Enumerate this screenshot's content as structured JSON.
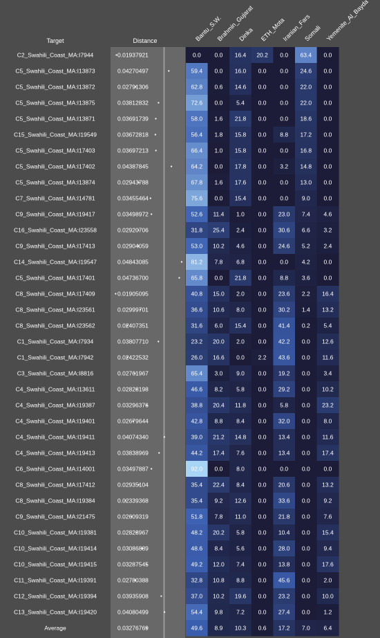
{
  "chart_data": {
    "type": "heatmap",
    "header": {
      "target": "Target",
      "distance": "Distance"
    },
    "columns": [
      "Bantu_S.W.",
      "Brahmin_Gujarat",
      "Dinka",
      "ETH_Mota",
      "Iranian_Fars",
      "Somali",
      "Yemenite_Al_Bayda"
    ],
    "rows": [
      {
        "target": "C2_Swahili_Coast_MA:I7944",
        "distance": "0.01937921",
        "values": [
          0.0,
          0.0,
          16.4,
          20.2,
          0.0,
          63.4,
          0.0
        ]
      },
      {
        "target": "C5_Swahili_Coast_MA:I13873",
        "distance": "0.04270497",
        "values": [
          59.4,
          0.0,
          16.0,
          0.0,
          0.0,
          24.6,
          0.0
        ]
      },
      {
        "target": "C5_Swahili_Coast_MA:I13872",
        "distance": "0.02791306",
        "values": [
          62.8,
          0.6,
          14.6,
          0.0,
          0.0,
          22.0,
          0.0
        ]
      },
      {
        "target": "C5_Swahili_Coast_MA:I13875",
        "distance": "0.03812832",
        "values": [
          72.6,
          0.0,
          5.4,
          0.0,
          0.0,
          22.0,
          0.0
        ]
      },
      {
        "target": "C5_Swahili_Coast_MA:I13871",
        "distance": "0.03691739",
        "values": [
          58.0,
          1.6,
          21.8,
          0.0,
          0.0,
          18.6,
          0.0
        ]
      },
      {
        "target": "C15_Swahili_Coast_MA:I19549",
        "distance": "0.03672818",
        "values": [
          56.4,
          1.8,
          15.8,
          0.0,
          8.8,
          17.2,
          0.0
        ]
      },
      {
        "target": "C5_Swahili_Coast_MA:I17403",
        "distance": "0.03697213",
        "values": [
          66.4,
          1.0,
          15.8,
          0.0,
          0.0,
          16.8,
          0.0
        ]
      },
      {
        "target": "C5_Swahili_Coast_MA:I17402",
        "distance": "0.04387845",
        "values": [
          64.2,
          0.0,
          17.8,
          0.0,
          3.2,
          14.8,
          0.0
        ]
      },
      {
        "target": "C5_Swahili_Coast_MA:I13874",
        "distance": "0.02943788",
        "values": [
          67.8,
          1.6,
          17.6,
          0.0,
          0.0,
          13.0,
          0.0
        ]
      },
      {
        "target": "C7_Swahili_Coast_MA:I14781",
        "distance": "0.03455464",
        "values": [
          75.6,
          0.0,
          15.4,
          0.0,
          0.0,
          9.0,
          0.0
        ]
      },
      {
        "target": "C9_Swahili_Coast_MA:I19417",
        "distance": "0.03498972",
        "values": [
          52.6,
          11.4,
          1.0,
          0.0,
          23.0,
          7.4,
          4.6
        ]
      },
      {
        "target": "C16_Swahili_Coast_MA:I23558",
        "distance": "0.02920706",
        "values": [
          31.8,
          25.4,
          2.4,
          0.0,
          30.6,
          6.6,
          3.2
        ]
      },
      {
        "target": "C9_Swahili_Coast_MA:I17413",
        "distance": "0.02904059",
        "values": [
          53.0,
          10.2,
          4.6,
          0.0,
          24.6,
          5.2,
          2.4
        ]
      },
      {
        "target": "C14_Swahili_Coast_MA:I19547",
        "distance": "0.04843085",
        "values": [
          81.2,
          7.8,
          6.8,
          0.0,
          0.0,
          4.2,
          0.0
        ]
      },
      {
        "target": "C5_Swahili_Coast_MA:I17401",
        "distance": "0.04736700",
        "values": [
          65.8,
          0.0,
          21.8,
          0.0,
          8.8,
          3.6,
          0.0
        ]
      },
      {
        "target": "C8_Swahili_Coast_MA:I17409",
        "distance": "0.01905095",
        "values": [
          40.8,
          15.0,
          2.0,
          0.0,
          23.6,
          2.2,
          16.4
        ]
      },
      {
        "target": "C8_Swahili_Coast_MA:I23561",
        "distance": "0.02999701",
        "values": [
          36.6,
          10.6,
          8.0,
          0.0,
          30.2,
          1.4,
          13.2
        ]
      },
      {
        "target": "C8_Swahili_Coast_MA:I23562",
        "distance": "0.02407351",
        "values": [
          31.6,
          6.0,
          15.4,
          0.0,
          41.4,
          0.2,
          5.4
        ]
      },
      {
        "target": "C1_Swahili_Coast_MA:I7934",
        "distance": "0.03807710",
        "values": [
          23.2,
          20.0,
          2.0,
          0.0,
          42.2,
          0.0,
          12.6
        ]
      },
      {
        "target": "C1_Swahili_Coast_MA:I7942",
        "distance": "0.02422532",
        "values": [
          26.0,
          16.6,
          0.0,
          2.2,
          43.6,
          0.0,
          11.6
        ]
      },
      {
        "target": "C3_Swahili_Coast_MA:I8816",
        "distance": "0.02761967",
        "values": [
          65.4,
          3.0,
          9.0,
          0.0,
          19.2,
          0.0,
          3.4
        ]
      },
      {
        "target": "C4_Swahili_Coast_MA:I13611",
        "distance": "0.02828198",
        "values": [
          46.6,
          8.2,
          5.8,
          0.0,
          29.2,
          0.0,
          10.2
        ]
      },
      {
        "target": "C4_Swahili_Coast_MA:I19387",
        "distance": "0.03296376",
        "values": [
          38.8,
          20.4,
          11.8,
          0.0,
          5.8,
          0.0,
          23.2
        ]
      },
      {
        "target": "C4_Swahili_Coast_MA:I19401",
        "distance": "0.02679644",
        "values": [
          42.8,
          8.8,
          8.4,
          0.0,
          32.0,
          0.0,
          8.0
        ]
      },
      {
        "target": "C4_Swahili_Coast_MA:I19411",
        "distance": "0.04074340",
        "values": [
          39.0,
          21.2,
          14.8,
          0.0,
          13.4,
          0.0,
          11.6
        ]
      },
      {
        "target": "C4_Swahili_Coast_MA:I19413",
        "distance": "0.03838969",
        "values": [
          44.2,
          17.4,
          7.6,
          0.0,
          13.4,
          0.0,
          17.4
        ]
      },
      {
        "target": "C6_Swahili_Coast_MA:I14001",
        "distance": "0.03497887",
        "values": [
          92.0,
          0.0,
          8.0,
          0.0,
          0.0,
          0.0,
          0.0
        ]
      },
      {
        "target": "C8_Swahili_Coast_MA:I17412",
        "distance": "0.02935104",
        "values": [
          35.4,
          22.4,
          8.4,
          0.0,
          20.6,
          0.0,
          13.2
        ]
      },
      {
        "target": "C8_Swahili_Coast_MA:I19384",
        "distance": "0.02339368",
        "values": [
          35.4,
          9.2,
          12.6,
          0.0,
          33.6,
          0.0,
          9.2
        ]
      },
      {
        "target": "C9_Swahili_Coast_MA:I21475",
        "distance": "0.02609319",
        "values": [
          51.8,
          7.8,
          11.0,
          0.0,
          21.8,
          0.0,
          7.6
        ]
      },
      {
        "target": "C10_Swahili_Coast_MA:I19381",
        "distance": "0.02823967",
        "values": [
          48.2,
          20.2,
          5.8,
          0.0,
          10.4,
          0.0,
          15.4
        ]
      },
      {
        "target": "C10_Swahili_Coast_MA:I19414",
        "distance": "0.03086889",
        "values": [
          48.6,
          8.4,
          5.6,
          0.0,
          28.0,
          0.0,
          9.4
        ]
      },
      {
        "target": "C10_Swahili_Coast_MA:I19415",
        "distance": "0.03287545",
        "values": [
          49.2,
          12.0,
          7.4,
          0.0,
          13.8,
          0.0,
          17.6
        ]
      },
      {
        "target": "C11_Swahili_Coast_MA:I19391",
        "distance": "0.02780388",
        "values": [
          32.8,
          10.8,
          8.8,
          0.0,
          45.6,
          0.0,
          2.0
        ]
      },
      {
        "target": "C12_Swahili_Coast_MA:I19394",
        "distance": "0.03935908",
        "values": [
          37.0,
          10.2,
          19.6,
          0.0,
          23.2,
          0.0,
          10.0
        ]
      },
      {
        "target": "C13_Swahili_Coast_MA:I19420",
        "distance": "0.04080499",
        "values": [
          54.4,
          9.8,
          7.2,
          0.0,
          27.4,
          0.0,
          1.2
        ]
      }
    ],
    "average": {
      "target": "Average",
      "distance": "0.03276769",
      "values": [
        49.6,
        8.9,
        10.3,
        0.6,
        17.2,
        7.0,
        6.4
      ]
    },
    "color_scale": {
      "low": "#1c1c38",
      "mid": "#3b5fb0",
      "high": "#a8d4f6",
      "max_value": 92.0
    }
  }
}
